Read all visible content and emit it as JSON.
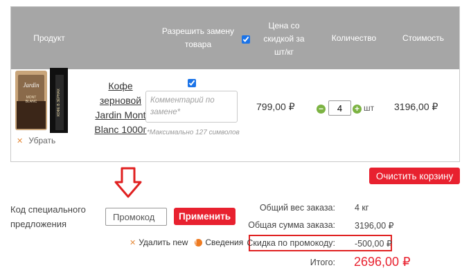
{
  "header": {
    "product": "Продукт",
    "replace_line1": "Разрешить замену",
    "replace_line2": "товара",
    "price_line1": "Цена со",
    "price_line2": "скидкой за",
    "price_line3": "шт/кг",
    "quantity": "Количество",
    "cost": "Стоимость"
  },
  "item": {
    "name_line1": "Кофе",
    "name_line2": "зерновой",
    "name_line3": "Jardin Mont",
    "name_line4": "Blanc 1000г",
    "remove_label": "Убрать",
    "comment_placeholder": "Комментарий по замене*",
    "max_note": "*Максимально 127 символов",
    "price": "799,00 ₽",
    "quantity": "4",
    "unit": "шт",
    "cost": "3196,00 ₽",
    "replace_allowed": true,
    "package_brand": "Jardin",
    "package_name_1": "MONT",
    "package_name_2": "BLANC",
    "package_side_text": "КОФЕ В ЗЁРНАХ"
  },
  "clear_cart_label": "Очистить корзину",
  "promo": {
    "label_line1": "Код специального",
    "label_line2": "предложения",
    "placeholder": "Промокод",
    "apply_label": "Применить",
    "delete_label": "Удалить new",
    "info_label": "Сведения"
  },
  "summary": {
    "weight_label": "Общий вес заказа:",
    "weight_value": "4 кг",
    "sum_label": "Общая сумма заказа:",
    "sum_value": "3196,00 ₽",
    "discount_label": "Скидка по промокоду:",
    "discount_value": "-500,00 ₽",
    "total_label": "Итого:",
    "total_value": "2696,00 ₽"
  },
  "colors": {
    "accent_red": "#e8212f",
    "header_gray": "#a6a6a6",
    "qty_green": "#7cb342",
    "info_orange": "#ee7b22"
  }
}
